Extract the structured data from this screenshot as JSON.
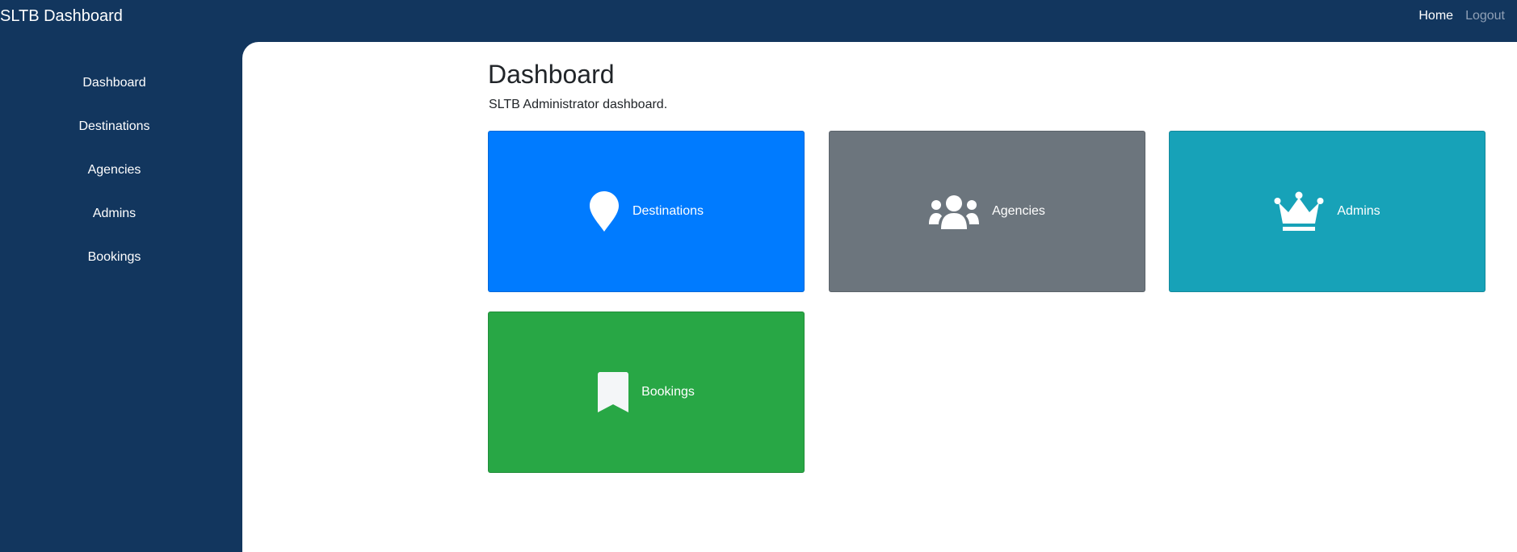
{
  "navbar": {
    "brand": "SLTB Dashboard",
    "links": {
      "home": "Home",
      "logout": "Logout"
    }
  },
  "sidebar": {
    "items": [
      {
        "label": "Dashboard"
      },
      {
        "label": "Destinations"
      },
      {
        "label": "Agencies"
      },
      {
        "label": "Admins"
      },
      {
        "label": "Bookings"
      }
    ]
  },
  "main": {
    "title": "Dashboard",
    "subtitle": "SLTB Administrator dashboard.",
    "cards": [
      {
        "label": "Destinations",
        "icon": "map-marker-icon",
        "color": "#007bff"
      },
      {
        "label": "Agencies",
        "icon": "users-icon",
        "color": "#6c757d"
      },
      {
        "label": "Admins",
        "icon": "crown-icon",
        "color": "#17a2b8"
      },
      {
        "label": "Bookings",
        "icon": "bookmark-icon",
        "color": "#28a745"
      }
    ]
  },
  "colors": {
    "navbar_bg": "#12365e",
    "sidebar_bg": "#12365e",
    "content_bg": "#ffffff",
    "logout_text": "#8fa0b6"
  }
}
